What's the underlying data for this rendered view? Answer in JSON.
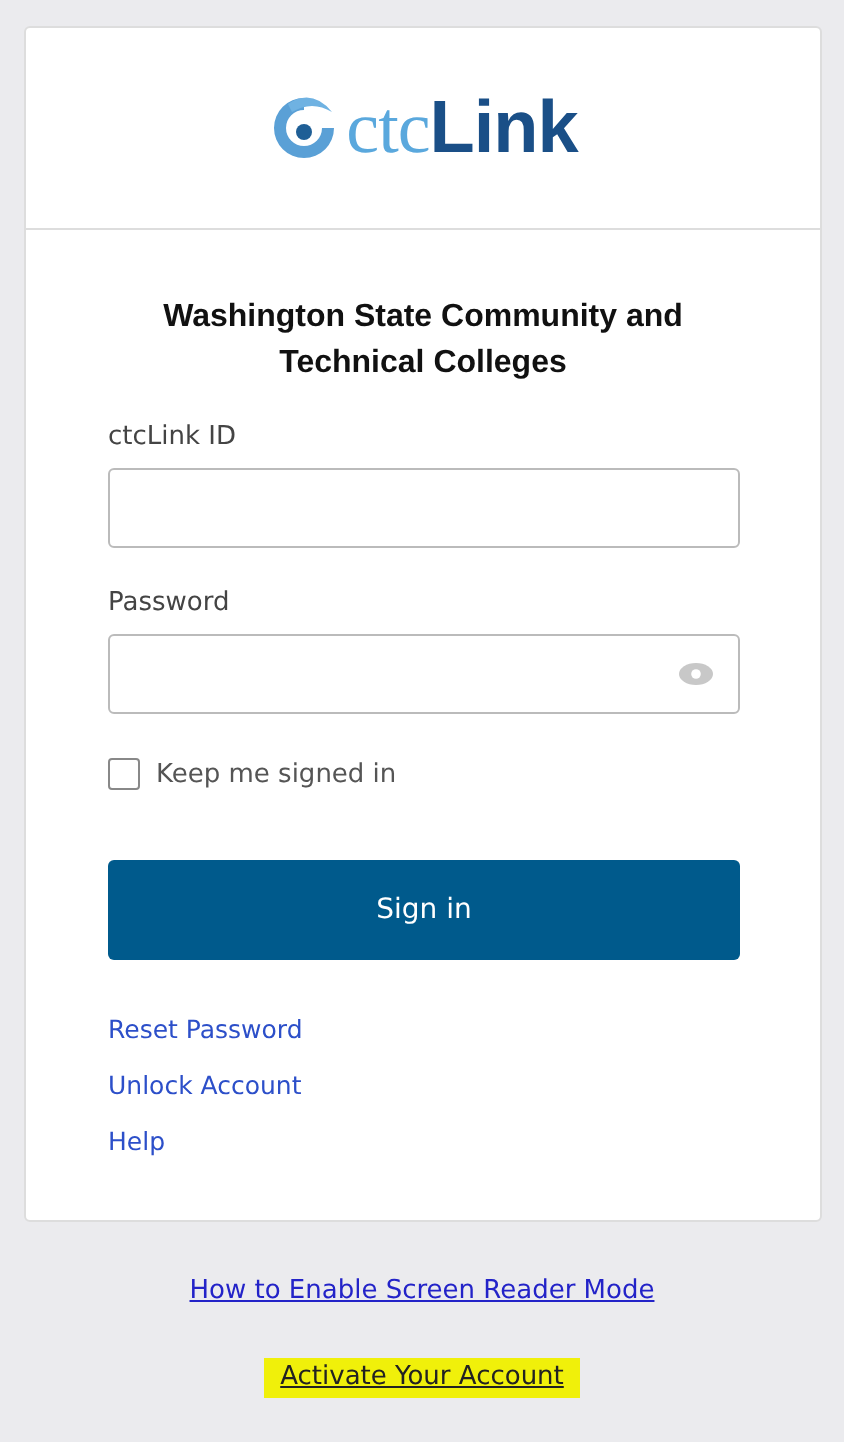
{
  "logo": {
    "light_part": "ctc",
    "dark_part": "Link"
  },
  "heading": "Washington State Community and Technical Colleges",
  "fields": [
    {
      "label": "ctcLink ID",
      "kind": "text"
    },
    {
      "label": "Password",
      "kind": "password"
    }
  ],
  "remember": {
    "label": "Keep me signed in",
    "checked": false
  },
  "sign_in_button": "Sign in",
  "help_links": [
    "Reset Password",
    "Unlock Account",
    "Help"
  ],
  "footer_links": [
    {
      "text": "How to Enable Screen Reader Mode",
      "highlighted": false
    },
    {
      "text": "Activate Your Account",
      "highlighted": true
    }
  ]
}
